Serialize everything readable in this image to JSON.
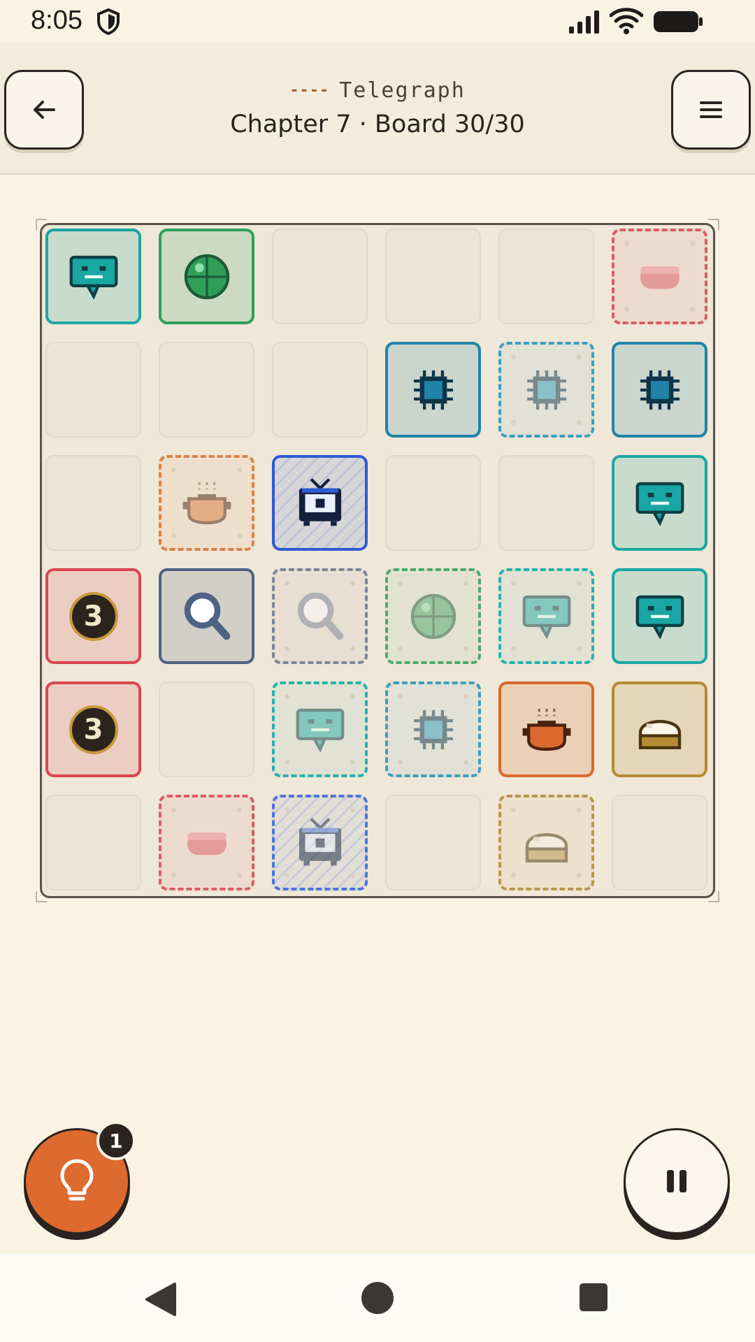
{
  "status_bar": {
    "time": "8:05"
  },
  "header": {
    "subtitle_dash": "----",
    "subtitle": "Telegraph",
    "title": "Chapter 7 · Board 30/30",
    "back_icon": "arrow-left-icon",
    "menu_icon": "hamburger-menu-icon"
  },
  "board": {
    "size": "6x6",
    "rows": [
      [
        {
          "state": "placed",
          "item": "speech-bubble",
          "color": "#1aa6a3"
        },
        {
          "state": "placed",
          "item": "green-orb",
          "color": "#2f9f58"
        },
        {
          "state": "empty"
        },
        {
          "state": "empty"
        },
        {
          "state": "empty"
        },
        {
          "state": "target",
          "item": "pink-capsule",
          "color": "#d95c63"
        }
      ],
      [
        {
          "state": "empty"
        },
        {
          "state": "empty"
        },
        {
          "state": "empty"
        },
        {
          "state": "placed",
          "item": "chip",
          "color": "#1f84a8"
        },
        {
          "state": "target",
          "item": "chip",
          "color": "#3a9ec2"
        },
        {
          "state": "placed",
          "item": "chip",
          "color": "#1f84a8"
        }
      ],
      [
        {
          "state": "empty"
        },
        {
          "state": "target",
          "item": "pot",
          "color": "#dc8044"
        },
        {
          "state": "placed",
          "item": "tv",
          "color": "#2d5ad6"
        },
        {
          "state": "empty"
        },
        {
          "state": "empty"
        },
        {
          "state": "placed",
          "item": "speech-bubble",
          "color": "#1aa6a3"
        }
      ],
      [
        {
          "state": "number",
          "number": "3",
          "color": "#d94651"
        },
        {
          "state": "placed",
          "item": "magnifier",
          "color": "#4c6384"
        },
        {
          "state": "target",
          "item": "magnifier",
          "color": "#7a8598"
        },
        {
          "state": "target",
          "item": "green-orb",
          "color": "#4da86a"
        },
        {
          "state": "target",
          "item": "speech-bubble",
          "color": "#28b0ad"
        },
        {
          "state": "placed",
          "item": "speech-bubble",
          "color": "#1aa6a3"
        }
      ],
      [
        {
          "state": "number",
          "number": "3",
          "color": "#d94651"
        },
        {
          "state": "empty"
        },
        {
          "state": "target",
          "item": "speech-bubble",
          "color": "#28b0ad"
        },
        {
          "state": "target",
          "item": "chip",
          "color": "#3a9ec2"
        },
        {
          "state": "placed",
          "item": "pot",
          "color": "#d9692c"
        },
        {
          "state": "placed",
          "item": "bread",
          "color": "#b58a33"
        }
      ],
      [
        {
          "state": "empty"
        },
        {
          "state": "target",
          "item": "pink-capsule",
          "color": "#d95c63"
        },
        {
          "state": "target",
          "item": "tv",
          "color": "#4a76d9"
        },
        {
          "state": "empty"
        },
        {
          "state": "target",
          "item": "bread",
          "color": "#b8964c"
        },
        {
          "state": "empty"
        }
      ]
    ]
  },
  "controls": {
    "hint_icon": "lightbulb-icon",
    "hint_count": "1",
    "pause_icon": "pause-icon"
  },
  "nav_bar": {
    "back_icon": "nav-back-icon",
    "home_icon": "nav-home-icon",
    "recents_icon": "nav-recents-icon"
  }
}
